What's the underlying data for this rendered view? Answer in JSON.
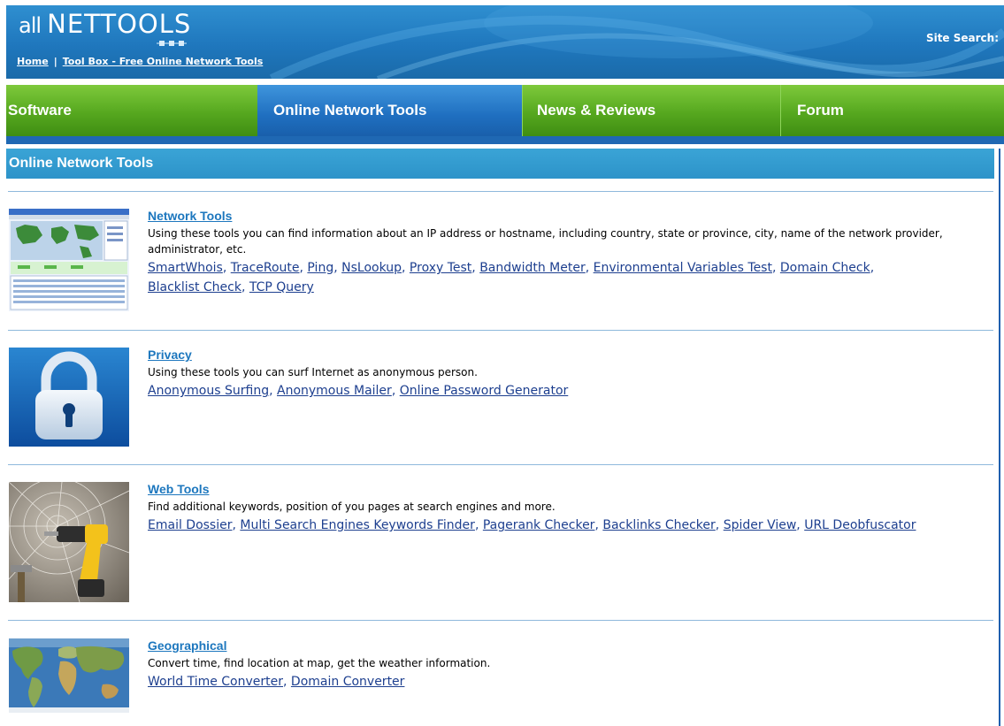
{
  "header": {
    "logo_all": "all",
    "logo_net": "NETTOOLS",
    "breadcrumb": {
      "home": "Home",
      "separator": "|",
      "current": "Tool Box - Free Online Network Tools"
    },
    "site_search": "Site Search:"
  },
  "nav": {
    "items": [
      {
        "label": "Software"
      },
      {
        "label": "Online Network Tools"
      },
      {
        "label": "News & Reviews"
      },
      {
        "label": "Forum"
      }
    ]
  },
  "content": {
    "heading": "Online Network Tools",
    "sections": [
      {
        "title": "Network Tools",
        "description": "Using these tools you can find information about an IP address or hostname, including country, state or province, city, name of the network provider, administrator, etc.",
        "links": [
          "SmartWhois",
          "TraceRoute",
          "Ping",
          "NsLookup",
          "Proxy Test",
          "Bandwidth Meter",
          "Environmental Variables Test",
          "Domain Check",
          "Blacklist Check",
          "TCP Query"
        ]
      },
      {
        "title": "Privacy",
        "description": "Using these tools you can surf Internet as anonymous person.",
        "links": [
          "Anonymous Surfing",
          "Anonymous Mailer",
          "Online Password Generator"
        ]
      },
      {
        "title": "Web Tools",
        "description": "Find additional keywords, position of you pages at search engines and more.",
        "links": [
          "Email Dossier",
          "Multi Search Engines Keywords Finder",
          "Pagerank Checker",
          "Backlinks Checker",
          "Spider View",
          "URL Deobfuscator"
        ]
      },
      {
        "title": "Geographical",
        "description": "Convert time, find location at map, get the weather information.",
        "links": [
          "World Time Converter",
          "Domain Converter"
        ]
      }
    ]
  },
  "colors": {
    "header_blue": "#1f77bd",
    "nav_green": "#56a81f",
    "nav_active_blue": "#1f6fc0",
    "section_bar": "#2d93c9",
    "link_title": "#1d77be",
    "link": "#1d3f8f"
  },
  "icons": {
    "network": "network-screenshot-icon",
    "privacy": "padlock-icon",
    "web": "drill-spiderweb-icon",
    "geo": "world-map-icon"
  }
}
